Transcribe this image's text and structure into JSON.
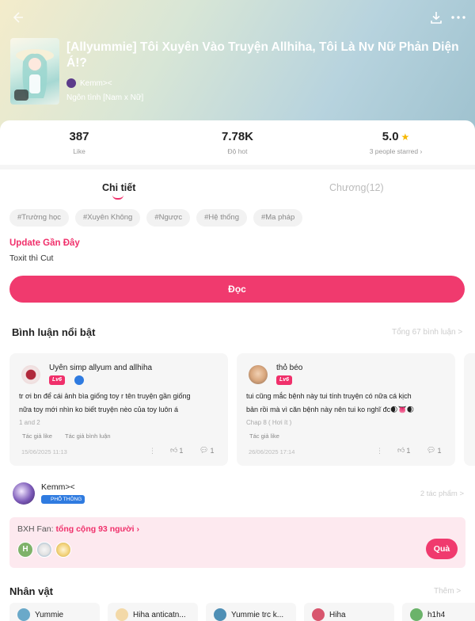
{
  "story": {
    "title": "[Allyummie] Tôi Xuyên Vào Truyện Allhiha, Tôi Là Nv Nữ Phản Diện Á!?",
    "author": "Kemm><",
    "genre": "Ngôn tình [Nam x Nữ]"
  },
  "stats": {
    "likes_value": "387",
    "likes_label": "Like",
    "hot_value": "7.78K",
    "hot_label": "Độ hot",
    "rating_value": "5.0",
    "rating_label": "3 people starred ›"
  },
  "tabs": {
    "details": "Chi tiết",
    "chapters": "Chương(12)"
  },
  "tags": [
    "#Trường học",
    "#Xuyên Không",
    "#Ngược",
    "#Hệ thống",
    "#Ma pháp"
  ],
  "update": {
    "title": "Update Gần Đây",
    "text": "Toxit thì Cut"
  },
  "read_button": "Đọc",
  "comments_section": {
    "title": "Bình luận nổi bật",
    "total_link": "Tổng 67 bình luận >",
    "comments": [
      {
        "user": "Uyên simp allyum and allhiha",
        "level": "Lv6",
        "line1": "tr ơi bn để cái ảnh bìa giống toy r tên truyện gần giống",
        "line2": "nữa toy mới nhìn ko biết truyện nèo của toy luôn á",
        "chapter": "1 and 2",
        "liked_by_author": "Tác giả like",
        "author_commented": "Tác giả bình luận",
        "date": "15/06/2025 11:13",
        "likes": "1",
        "replies": "1"
      },
      {
        "user": "thỏ béo",
        "level": "Lv6",
        "line1": "tui cũng mắc bệnh này tui tính truyện có nữa cá kịch",
        "line2": "bản rồi mà vì căn bệnh này nên tui ko nghĩ đc🌒👅🌒",
        "chapter": "Chap 8 ( Hơi ít )",
        "liked_by_author": "Tác giả like",
        "date": "26/06/2025 17:14",
        "likes": "1",
        "replies": "1"
      }
    ]
  },
  "author_block": {
    "name": "Kemm><",
    "badge": "PHỔ THÔNG",
    "works": "2 tác phẩm >"
  },
  "fans": {
    "prefix": "BXH Fan: ",
    "total": "tổng cộng 93 người",
    "arrow": "›",
    "gift_button": "Quà",
    "first_avatar_letter": "H"
  },
  "characters": {
    "title": "Nhân vật",
    "more": "Thêm >",
    "items": [
      "Yummie",
      "Hiha anticatn...",
      "Yummie trc k...",
      "Hiha",
      "h1h4"
    ]
  },
  "colors": {
    "accent": "#f03a6e",
    "badge_blue": "#2f7be0",
    "star": "#f6b800"
  }
}
